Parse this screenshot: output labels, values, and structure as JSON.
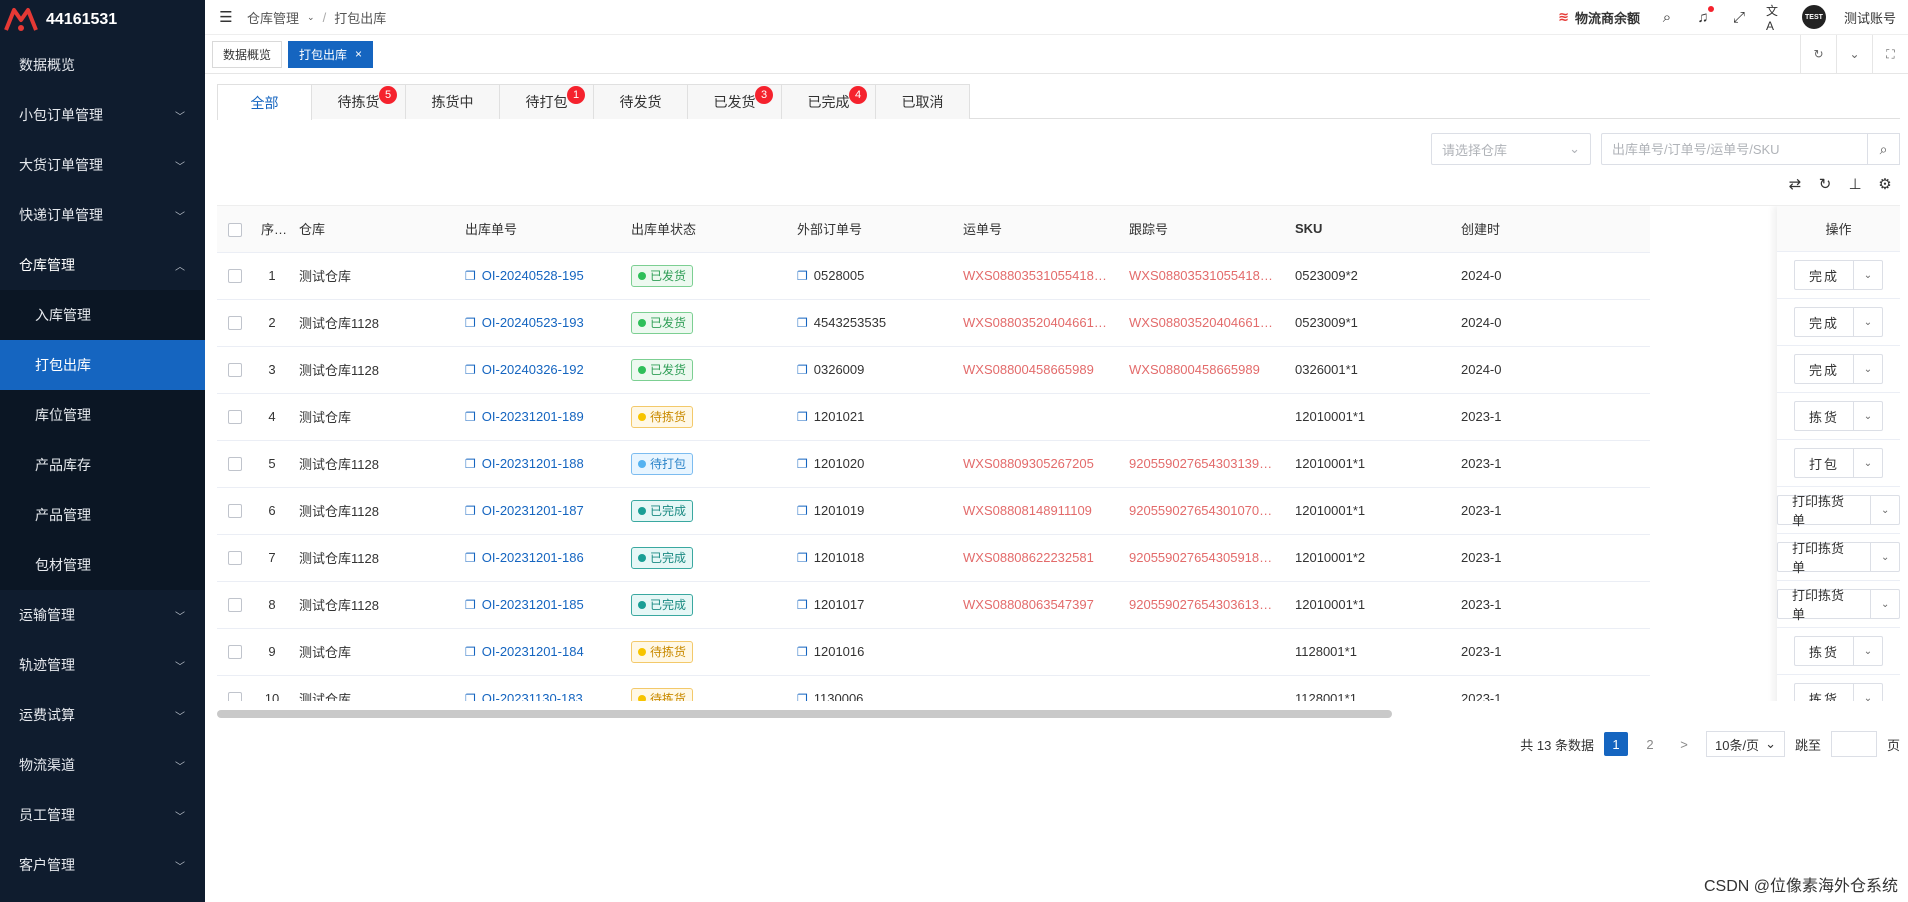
{
  "app": {
    "account_id": "44161531"
  },
  "sidebar": {
    "items": [
      {
        "label": "数据概览",
        "chevron": false
      },
      {
        "label": "小包订单管理",
        "chevron": true
      },
      {
        "label": "大货订单管理",
        "chevron": true
      },
      {
        "label": "快递订单管理",
        "chevron": true
      },
      {
        "label": "仓库管理",
        "chevron": true,
        "open": true
      }
    ],
    "sub_items": [
      {
        "label": "入库管理"
      },
      {
        "label": "打包出库",
        "active": true
      },
      {
        "label": "库位管理"
      },
      {
        "label": "产品库存"
      },
      {
        "label": "产品管理"
      },
      {
        "label": "包材管理"
      }
    ],
    "items_after": [
      {
        "label": "运输管理"
      },
      {
        "label": "轨迹管理"
      },
      {
        "label": "运费试算"
      },
      {
        "label": "物流渠道"
      },
      {
        "label": "员工管理"
      },
      {
        "label": "客户管理"
      }
    ]
  },
  "header": {
    "breadcrumb": [
      "仓库管理",
      "打包出库"
    ],
    "balance_label": "物流商余额",
    "avatar_text": "TEST",
    "user_name": "测试账号"
  },
  "tags": {
    "first": "数据概览",
    "active": "打包出库",
    "close": "×"
  },
  "status_tabs": [
    {
      "label": "全部",
      "badge": ""
    },
    {
      "label": "待拣货",
      "badge": "5"
    },
    {
      "label": "拣货中",
      "badge": ""
    },
    {
      "label": "待打包",
      "badge": "1"
    },
    {
      "label": "待发货",
      "badge": ""
    },
    {
      "label": "已发货",
      "badge": "3"
    },
    {
      "label": "已完成",
      "badge": "4"
    },
    {
      "label": "已取消",
      "badge": ""
    }
  ],
  "filters": {
    "warehouse_placeholder": "请选择仓库",
    "search_placeholder": "出库单号/订单号/运单号/SKU"
  },
  "table": {
    "headers": [
      "序号",
      "仓库",
      "出库单号",
      "出库单状态",
      "外部订单号",
      "运单号",
      "跟踪号",
      "SKU",
      "创建时",
      "操作"
    ],
    "rows": [
      {
        "no": "1",
        "warehouse": "测试仓库",
        "outbound": "OI-20240528-195",
        "status": "已发货",
        "status_color": "green",
        "ext": "0528005",
        "waybill": "WXS0880353105541831372...",
        "tracking": "WXS0880353105541831372...",
        "sku": "0523009*2",
        "created": "2024-0",
        "action": "完成"
      },
      {
        "no": "2",
        "warehouse": "测试仓库1128",
        "outbound": "OI-20240523-193",
        "status": "已发货",
        "status_color": "green",
        "ext": "4543253535",
        "waybill": "WXS0880352040466175805...",
        "tracking": "WXS0880352040466175805...",
        "sku": "0523009*1",
        "created": "2024-0",
        "action": "完成"
      },
      {
        "no": "3",
        "warehouse": "测试仓库1128",
        "outbound": "OI-20240326-192",
        "status": "已发货",
        "status_color": "green",
        "ext": "0326009",
        "waybill": "WXS08800458665989",
        "tracking": "WXS08800458665989",
        "sku": "0326001*1",
        "created": "2024-0",
        "action": "完成"
      },
      {
        "no": "4",
        "warehouse": "测试仓库",
        "outbound": "OI-20231201-189",
        "status": "待拣货",
        "status_color": "yellow",
        "ext": "1201021",
        "waybill": "",
        "tracking": "",
        "sku": "12010001*1",
        "created": "2023-1",
        "action": "拣货"
      },
      {
        "no": "5",
        "warehouse": "测试仓库1128",
        "outbound": "OI-20231201-188",
        "status": "待打包",
        "status_color": "blue",
        "ext": "1201020",
        "waybill": "WXS08809305267205",
        "tracking": "9205590276543031396981 0...",
        "sku": "12010001*1",
        "created": "2023-1",
        "action": "打包"
      },
      {
        "no": "6",
        "warehouse": "测试仓库1128",
        "outbound": "OI-20231201-187",
        "status": "已完成",
        "status_color": "teal",
        "ext": "1201019",
        "waybill": "WXS08808148911109",
        "tracking": "92055902765430107047442...",
        "sku": "12010001*1",
        "created": "2023-1",
        "action": "打印拣货单"
      },
      {
        "no": "7",
        "warehouse": "测试仓库1128",
        "outbound": "OI-20231201-186",
        "status": "已完成",
        "status_color": "teal",
        "ext": "1201018",
        "waybill": "WXS08808622232581",
        "tracking": "92055902765430591896896...",
        "sku": "12010001*2",
        "created": "2023-1",
        "action": "打印拣货单"
      },
      {
        "no": "8",
        "warehouse": "测试仓库1128",
        "outbound": "OI-20231201-185",
        "status": "已完成",
        "status_color": "teal",
        "ext": "1201017",
        "waybill": "WXS08808063547397",
        "tracking": "92055902765430361385322...",
        "sku": "12010001*1",
        "created": "2023-1",
        "action": "打印拣货单"
      },
      {
        "no": "9",
        "warehouse": "测试仓库",
        "outbound": "OI-20231201-184",
        "status": "待拣货",
        "status_color": "yellow",
        "ext": "1201016",
        "waybill": "",
        "tracking": "",
        "sku": "1128001*1",
        "created": "2023-1",
        "action": "拣货"
      },
      {
        "no": "10",
        "warehouse": "测试仓库",
        "outbound": "OI-20231130-183",
        "status": "待拣货",
        "status_color": "yellow",
        "ext": "1130006",
        "waybill": "",
        "tracking": "",
        "sku": "1128001*1",
        "created": "2023-1",
        "action": "拣货"
      }
    ]
  },
  "pager": {
    "total": "共 13 条数据",
    "pages": [
      "1",
      "2"
    ],
    "current": "1",
    "next": ">",
    "page_size": "10条/页",
    "jump_label": "跳至",
    "page_unit": "页"
  },
  "watermark": "CSDN @位像素海外仓系统"
}
